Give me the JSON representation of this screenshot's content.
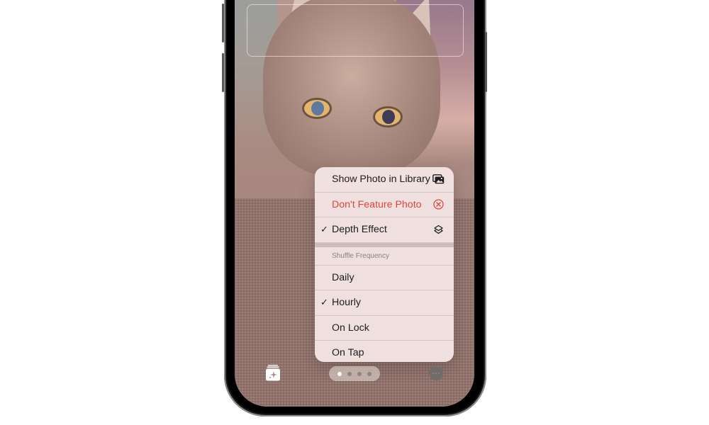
{
  "context_menu": {
    "actions": [
      {
        "label": "Show Photo in Library",
        "icon": "photo-library-icon",
        "checked": false,
        "destructive": false
      },
      {
        "label": "Don't Feature Photo",
        "icon": "x-circle-icon",
        "checked": false,
        "destructive": true
      },
      {
        "label": "Depth Effect",
        "icon": "layers-icon",
        "checked": true,
        "destructive": false
      }
    ],
    "section_header": "Shuffle Frequency",
    "frequency_options": [
      {
        "label": "Daily",
        "checked": false
      },
      {
        "label": "Hourly",
        "checked": true
      },
      {
        "label": "On Lock",
        "checked": false
      },
      {
        "label": "On Tap",
        "checked": false
      }
    ],
    "check_glyph": "✓"
  },
  "bottom_bar": {
    "gallery_icon": "photo-stack-sparkle-icon",
    "page_count": 4,
    "active_page": 1,
    "more_icon": "ellipsis-icon"
  },
  "colors": {
    "destructive": "#e3433c",
    "menu_bg": "#f3e5e3"
  }
}
